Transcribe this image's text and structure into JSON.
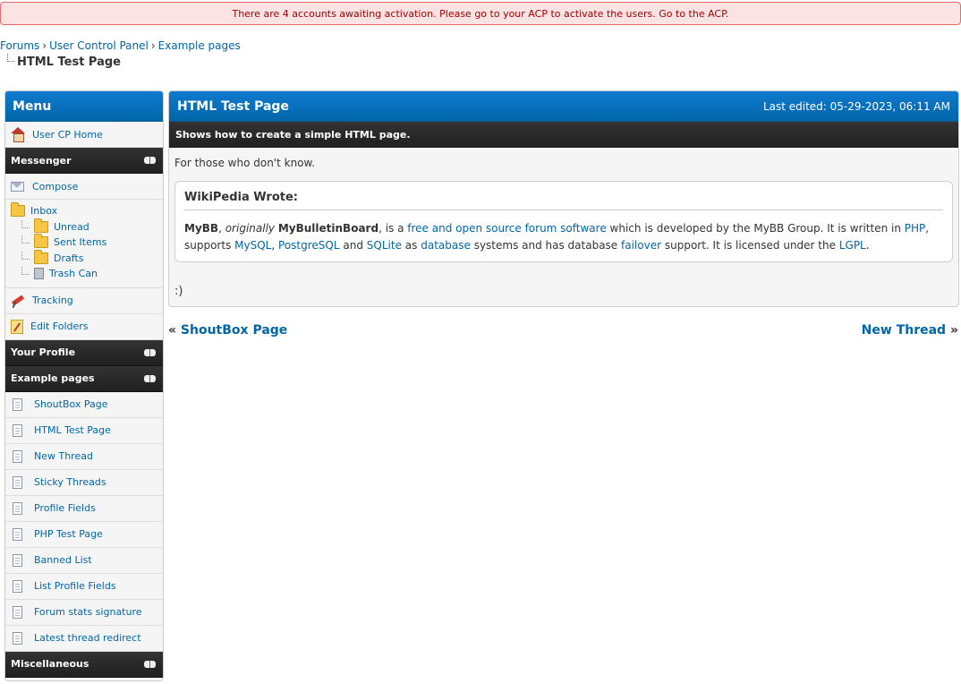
{
  "alert": {
    "text": "There are 4 accounts awaiting activation. Please go to your ACP to activate the users.",
    "link": "Go to the ACP."
  },
  "breadcrumb": {
    "items": [
      "Forums",
      "User Control Panel",
      "Example pages"
    ],
    "separator": "›",
    "active": "HTML Test Page"
  },
  "sidebar": {
    "title": "Menu",
    "home": "User CP Home",
    "messenger": {
      "title": "Messenger",
      "compose": "Compose",
      "inbox": "Inbox",
      "folders": [
        "Unread",
        "Sent Items",
        "Drafts"
      ],
      "trash": "Trash Can",
      "tracking": "Tracking",
      "edit_folders": "Edit Folders"
    },
    "your_profile": "Your Profile",
    "example_pages": {
      "title": "Example pages",
      "items": [
        "ShoutBox Page",
        "HTML Test Page",
        "New Thread",
        "Sticky Threads",
        "Profile Fields",
        "PHP Test Page",
        "Banned List",
        "List Profile Fields",
        "Forum stats signature",
        "Latest thread redirect"
      ]
    },
    "miscellaneous": "Miscellaneous"
  },
  "main": {
    "title": "HTML Test Page",
    "last_edited": "Last edited: 05-29-2023, 06:11 AM",
    "description": "Shows how to create a simple HTML page.",
    "intro": "For those who don't know.",
    "quote": {
      "header": "WikiPedia Wrote:",
      "mybb": "MyBB",
      "originally": "originally",
      "mybulletinboard": "MyBulletinBoard",
      "t1": ", is a",
      "link_free": "free and open source forum software",
      "t2": "which is developed by the MyBB Group. It is written in",
      "link_php": "PHP",
      "t3": ", supports",
      "link_mysql": "MySQL",
      "t4": ",",
      "link_pgsql": "PostgreSQL",
      "t5": "and",
      "link_sqlite": "SQLite",
      "t6": "as",
      "link_database": "database",
      "t7": "systems and has database",
      "link_failover": "failover",
      "t8": "support. It is licensed under the",
      "link_lgpl": "LGPL",
      "t9": "."
    },
    "smile": ":)"
  },
  "pagination": {
    "prev_arrow": "«",
    "prev": "ShoutBox Page",
    "next": "New Thread",
    "next_arrow": "»"
  },
  "colors": {
    "accent": "#0066a8",
    "header_dark": "#202020",
    "alert_bg": "#fbe3e4",
    "alert_text": "#a40000"
  }
}
